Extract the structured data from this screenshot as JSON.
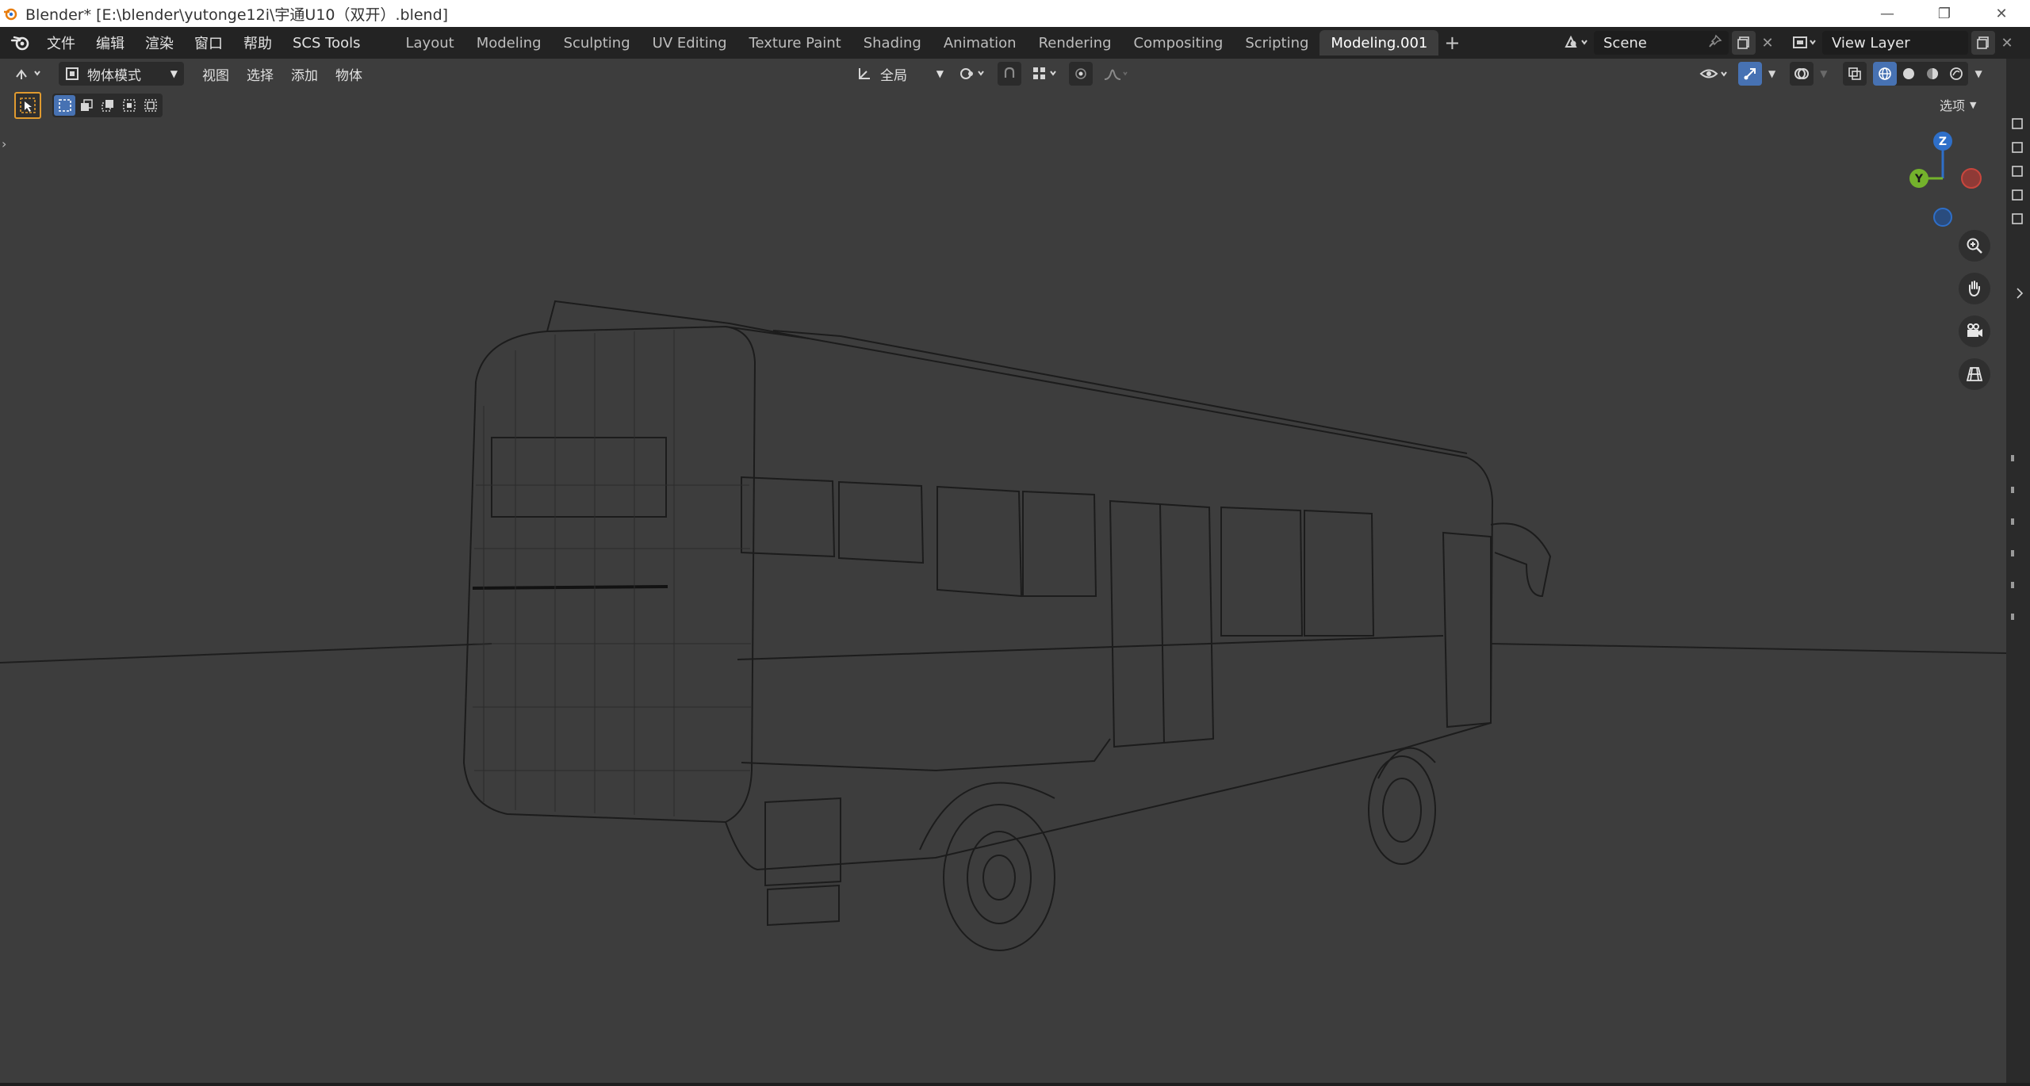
{
  "window": {
    "title": "Blender* [E:\\blender\\yutonge12i\\宇通U10（双开）.blend]",
    "minimize": "—",
    "restore": "❐",
    "close": "✕"
  },
  "menu": [
    "文件",
    "编辑",
    "渲染",
    "窗口",
    "帮助",
    "SCS Tools"
  ],
  "workspaces": [
    "Layout",
    "Modeling",
    "Sculpting",
    "UV Editing",
    "Texture Paint",
    "Shading",
    "Animation",
    "Rendering",
    "Compositing",
    "Scripting",
    "Modeling.001"
  ],
  "active_workspace_index": 10,
  "scene": {
    "value": "Scene"
  },
  "view_layer": {
    "value": "View Layer"
  },
  "viewport_header": {
    "mode": "物体模式",
    "menus": [
      "视图",
      "选择",
      "添加",
      "物体"
    ],
    "orientation": "全局"
  },
  "options_label": "选项",
  "gizmo": {
    "z": "Z",
    "y": "Y"
  },
  "colors": {
    "accent": "#4772b3",
    "tool_active": "#e09a2f",
    "axis_x": "#c9463d",
    "axis_y": "#74b32c",
    "axis_z": "#2e6fc9"
  }
}
